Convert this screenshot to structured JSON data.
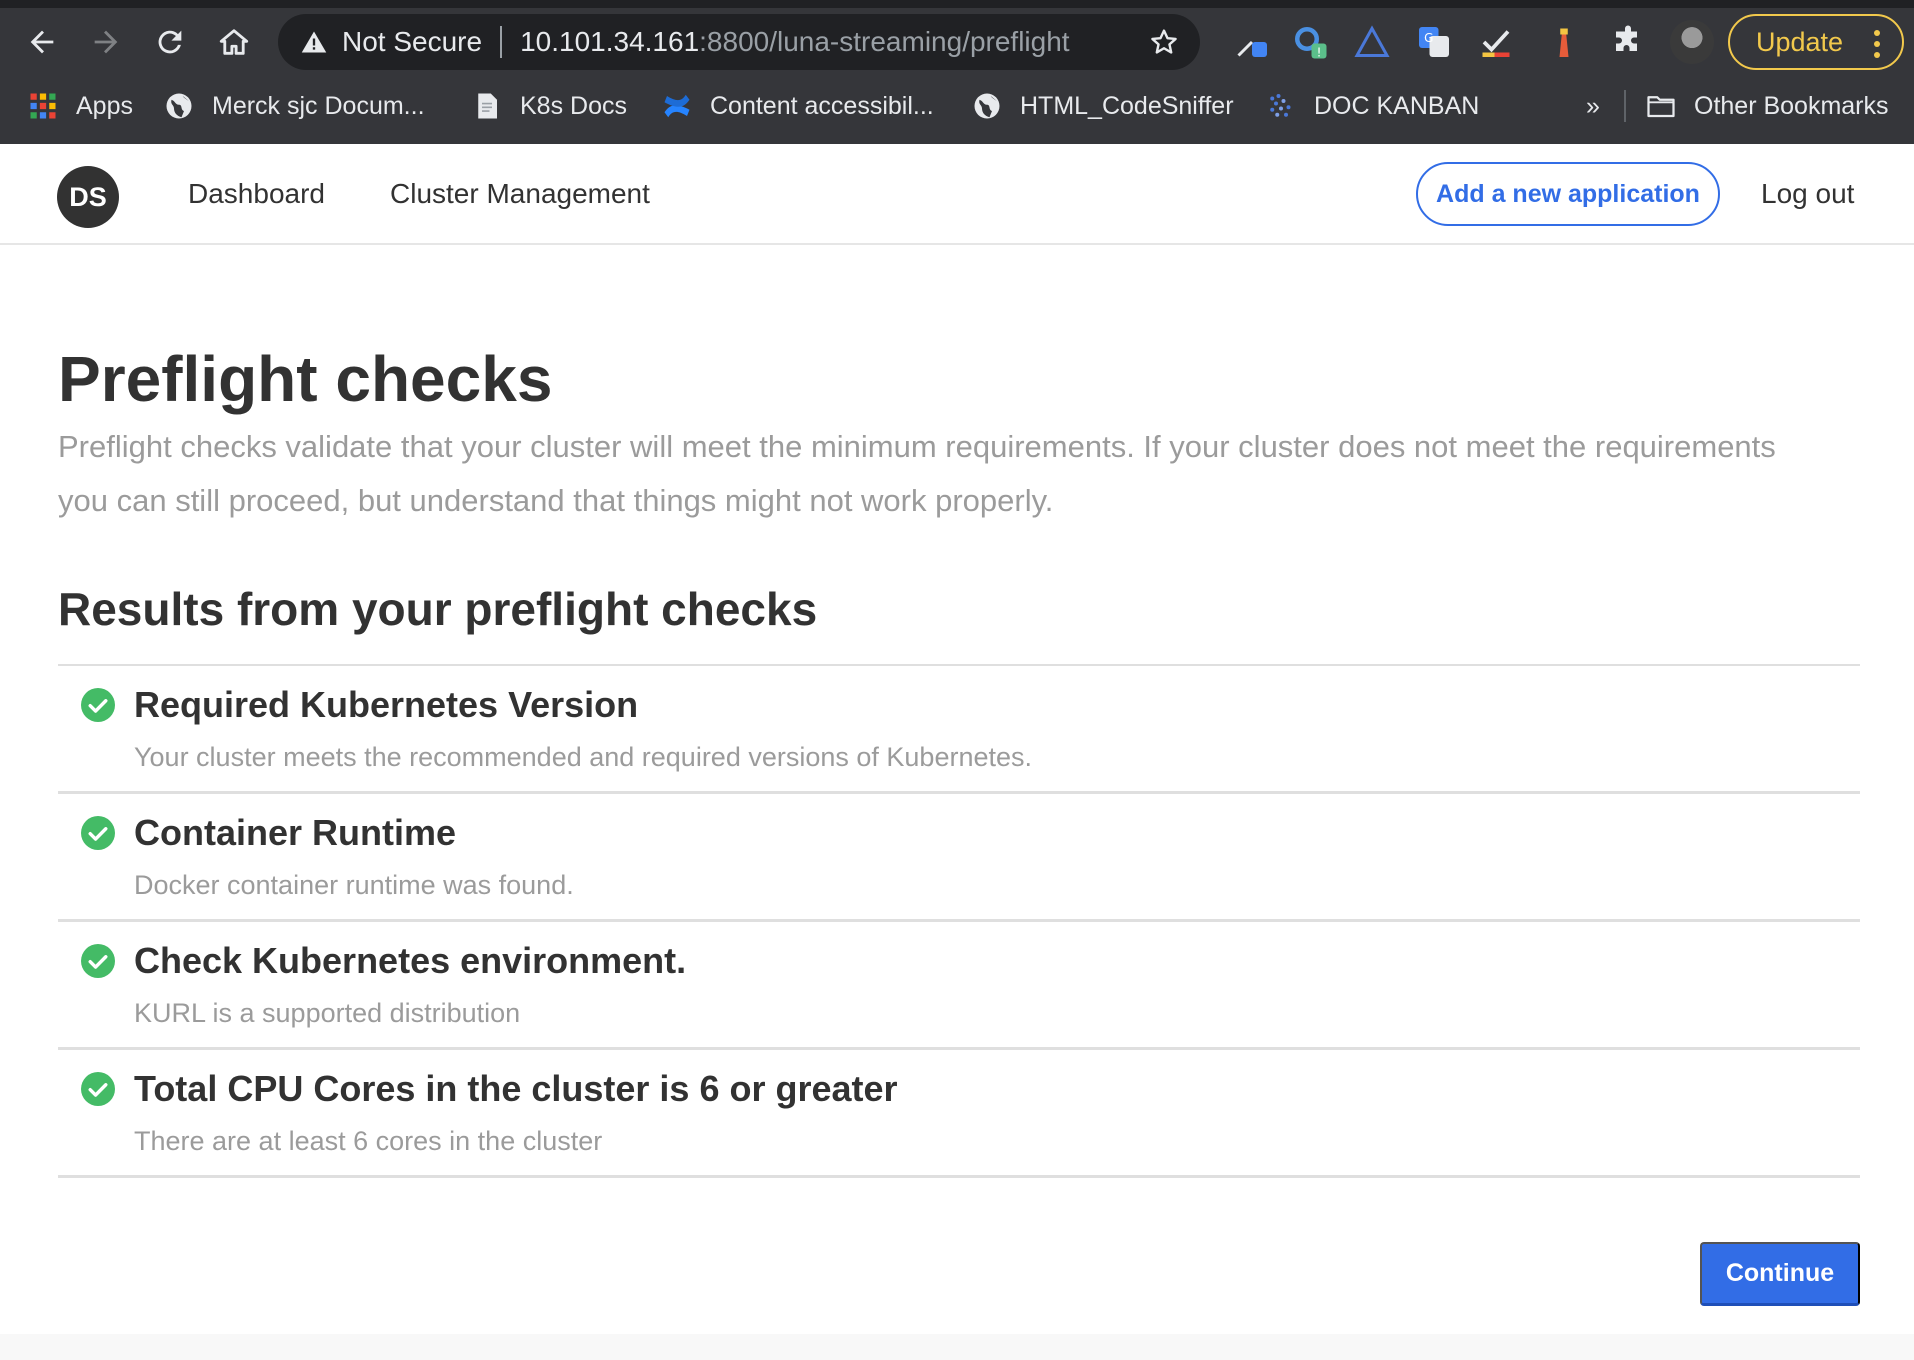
{
  "browser": {
    "security_label": "Not Secure",
    "url_host": "10.101.34.161",
    "url_path": ":8800/luna-streaming/preflight",
    "update_label": "Update",
    "bookmarks": [
      {
        "label": "Apps",
        "icon": "apps-grid-icon"
      },
      {
        "label": "Merck sjc Docum...",
        "icon": "globe-icon"
      },
      {
        "label": "K8s Docs",
        "icon": "document-icon"
      },
      {
        "label": "Content accessibil...",
        "icon": "confluence-icon"
      },
      {
        "label": "HTML_CodeSniffer",
        "icon": "globe-icon"
      },
      {
        "label": "DOC KANBAN",
        "icon": "kanban-icon"
      }
    ],
    "overflow_label": "»",
    "other_bookmarks_label": "Other Bookmarks"
  },
  "header": {
    "logo_text": "DS",
    "nav": [
      {
        "label": "Dashboard"
      },
      {
        "label": "Cluster Management"
      }
    ],
    "add_app_label": "Add a new application",
    "logout_label": "Log out"
  },
  "main": {
    "title": "Preflight checks",
    "description": "Preflight checks validate that your cluster will meet the minimum requirements. If your cluster does not meet the requirements you can still proceed, but understand that things might not work properly.",
    "results_title": "Results from your preflight checks",
    "results": [
      {
        "title": "Required Kubernetes Version",
        "message": "Your cluster meets the recommended and required versions of Kubernetes.",
        "status": "pass"
      },
      {
        "title": "Container Runtime",
        "message": "Docker container runtime was found.",
        "status": "pass"
      },
      {
        "title": "Check Kubernetes environment.",
        "message": "KURL is a supported distribution",
        "status": "pass"
      },
      {
        "title": "Total CPU Cores in the cluster is 6 or greater",
        "message": "There are at least 6 cores in the cluster",
        "status": "pass"
      }
    ],
    "continue_label": "Continue"
  },
  "colors": {
    "accent": "#326de6",
    "success": "#44bb66",
    "text": "#323232",
    "muted": "#9b9b9b"
  }
}
